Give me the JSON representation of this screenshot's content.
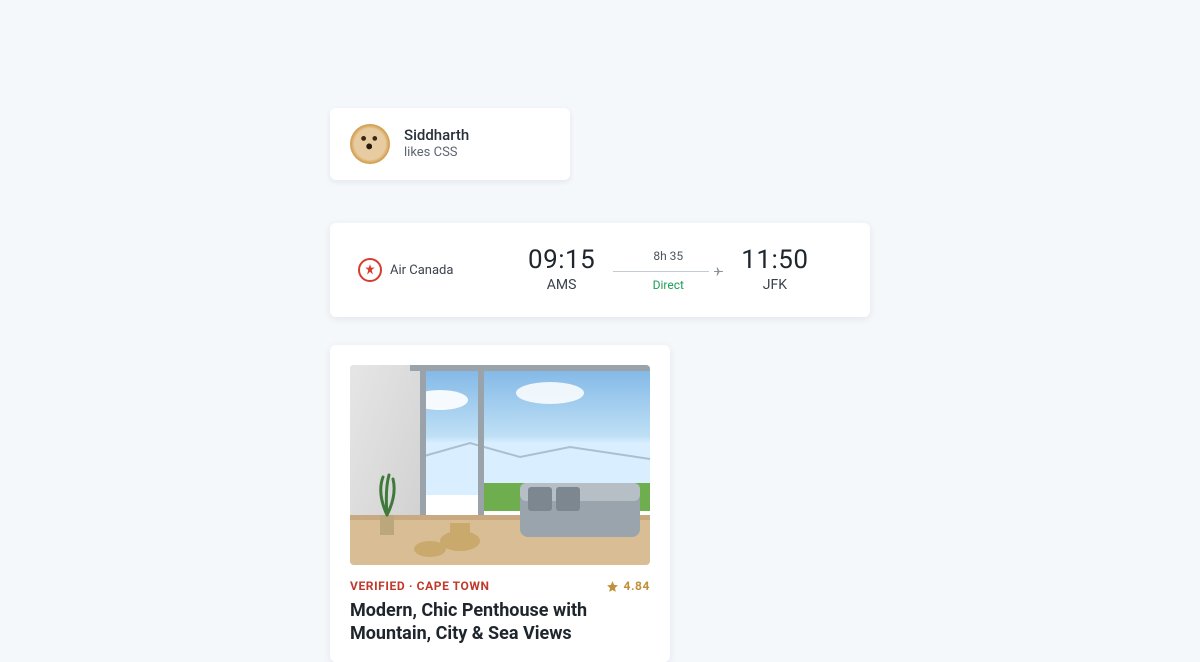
{
  "profile": {
    "name": "Siddharth",
    "subtitle": "likes CSS"
  },
  "flight": {
    "airline_name": "Air Canada",
    "depart_time": "09:15",
    "depart_code": "AMS",
    "duration": "8h 35",
    "stops": "Direct",
    "arrive_time": "11:50",
    "arrive_code": "JFK"
  },
  "listing": {
    "verified_tag": "VERIFIED · CAPE TOWN",
    "rating": "4.84",
    "title": "Modern, Chic Penthouse with Mountain, City & Sea Views"
  }
}
